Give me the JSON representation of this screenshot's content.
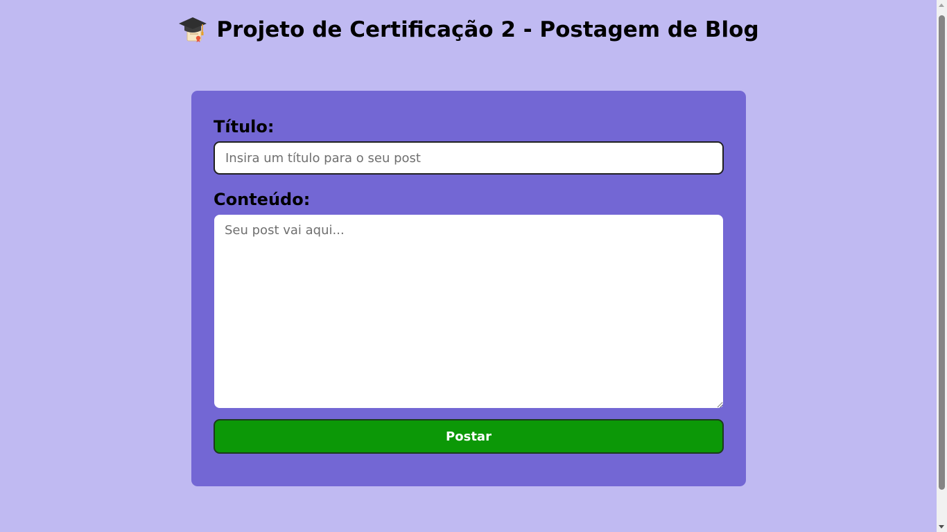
{
  "header": {
    "title": "Projeto de Certificação 2 - Postagem de Blog",
    "icon": "graduation-cap-icon"
  },
  "form": {
    "title_label": "Título:",
    "title_placeholder": "Insira um título para o seu post",
    "title_value": "",
    "content_label": "Conteúdo:",
    "content_placeholder": "Seu post vai aqui...",
    "content_value": "",
    "submit_label": "Postar"
  },
  "colors": {
    "background": "#c0baf2",
    "card": "#7367d4",
    "button": "#0c9807"
  }
}
